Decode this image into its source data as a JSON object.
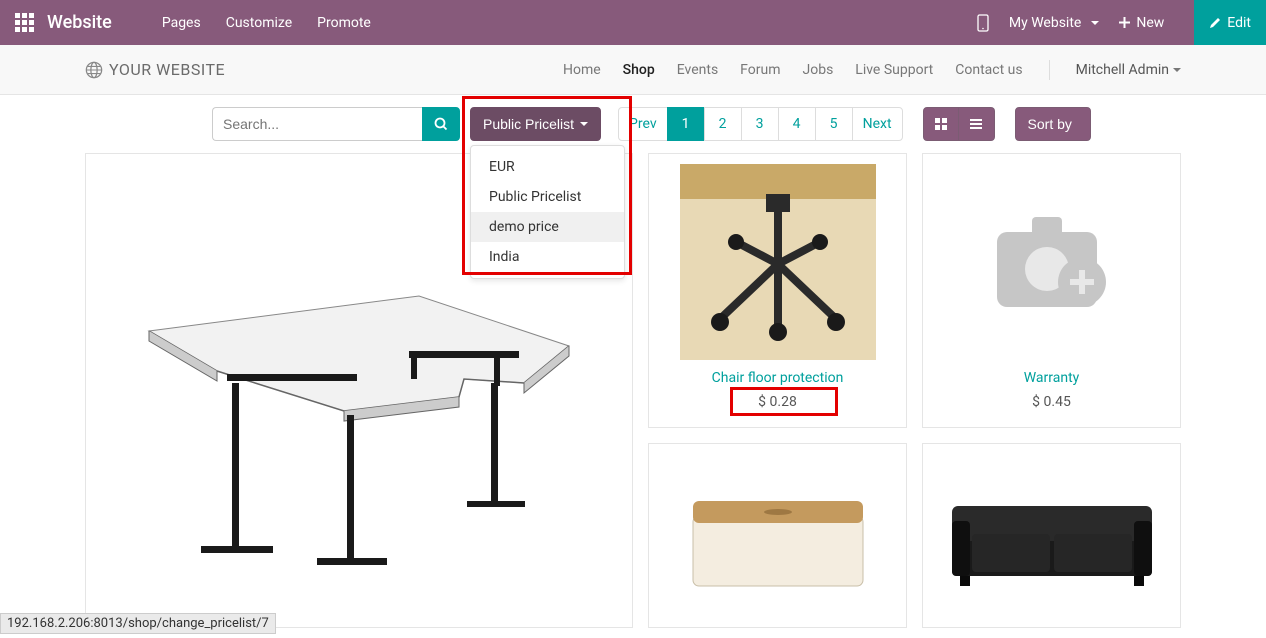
{
  "topbar": {
    "brand": "Website",
    "menu": [
      "Pages",
      "Customize",
      "Promote"
    ],
    "mywebsite": "My Website",
    "new": "New",
    "edit": "Edit"
  },
  "secondnav": {
    "logo": "YOUR WEBSITE",
    "links": [
      "Home",
      "Shop",
      "Events",
      "Forum",
      "Jobs",
      "Live Support",
      "Contact us"
    ],
    "active_index": 1,
    "user": "Mitchell Admin"
  },
  "toolbar": {
    "search_placeholder": "Search...",
    "pricelist_label": "Public Pricelist",
    "dropdown": [
      "EUR",
      "Public Pricelist",
      "demo price",
      "India"
    ],
    "dropdown_hover_index": 2,
    "pagination": {
      "prev": "Prev",
      "pages": [
        "1",
        "2",
        "3",
        "4",
        "5"
      ],
      "active_index": 0,
      "next": "Next"
    },
    "sort": "Sort by"
  },
  "products": {
    "chair": {
      "name": "Chair floor protection",
      "price": "$ 0.28"
    },
    "warranty": {
      "name": "Warranty",
      "price": "$ 0.45"
    }
  },
  "statusbar": "192.168.2.206:8013/shop/change_pricelist/7"
}
